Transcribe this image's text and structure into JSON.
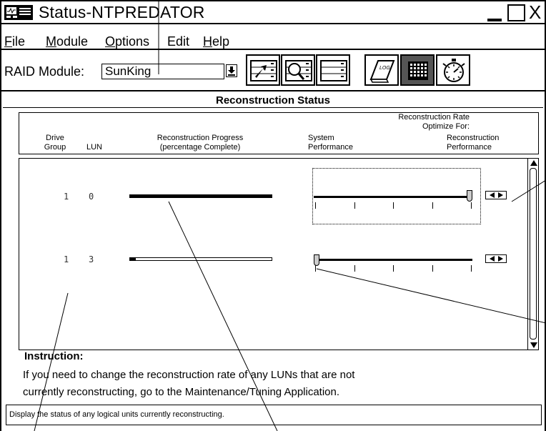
{
  "window": {
    "title": "Status-NTPREDATOR",
    "controls": {
      "close_label": "X"
    }
  },
  "menu": {
    "items": [
      {
        "label": "File",
        "u": "F",
        "rest": "ile"
      },
      {
        "label": "Module",
        "u": "M",
        "rest": "odule"
      },
      {
        "label": "Options",
        "u": "O",
        "rest": "ptions"
      },
      {
        "label": "Edit",
        "u": "",
        "rest": "Edit"
      },
      {
        "label": "Help",
        "u": "H",
        "rest": "elp"
      }
    ]
  },
  "toolbar": {
    "raid_label": "RAID Module:",
    "module_value": "SunKing",
    "log_icon_text": "LOG"
  },
  "section": {
    "title": "Reconstruction Status"
  },
  "columns": {
    "drive_group": "Drive\nGroup",
    "lun": "LUN",
    "progress": "Reconstruction Progress\n(percentage Complete)",
    "rate_title": "Reconstruction Rate\nOptimize For:",
    "system_perf": "System\nPerformance",
    "recon_perf": "Reconstruction\nPerformance"
  },
  "rows": [
    {
      "drive_group": "1",
      "lun": "0",
      "progress_fraction": 1.0,
      "rate_level": 1.0,
      "rate_steps": 5
    },
    {
      "drive_group": "1",
      "lun": "3",
      "progress_fraction": 0.04,
      "rate_level": 0.0,
      "rate_steps": 5
    }
  ],
  "instruction": {
    "title": "Instruction:",
    "line1": "If you need to change the reconstruction rate of any LUNs that are not",
    "line2": "currently reconstructing, go to the Maintenance/Tuning Application."
  },
  "status_bar": {
    "text": "Display the status of any logical units currently reconstructing."
  }
}
